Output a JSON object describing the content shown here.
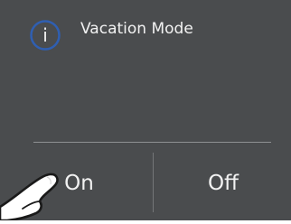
{
  "dialog": {
    "icon": "info-icon",
    "icon_glyph": "i",
    "title": "Vacation Mode",
    "on_label": "On",
    "off_label": "Off"
  },
  "overlay": {
    "pointer": "pointing-hand-icon"
  },
  "colors": {
    "background": "#4a4c4e",
    "icon_ring": "#2f5fb2",
    "text": "#f2f2f2",
    "divider": "#8e9092"
  }
}
